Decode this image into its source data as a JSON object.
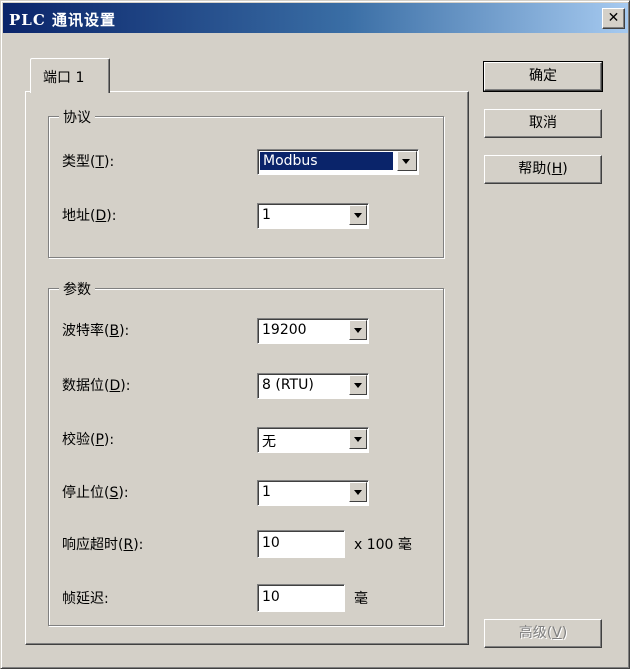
{
  "window": {
    "title": "PLC 通讯设置",
    "close_label": "✕"
  },
  "tabs": [
    {
      "label": "端口 1"
    }
  ],
  "protocol_group": {
    "title": "协议",
    "type": {
      "label_pre": "类型(",
      "hotkey": "T",
      "label_post": "):",
      "value": "Modbus"
    },
    "address": {
      "label_pre": "地址(",
      "hotkey": "D",
      "label_post": "):",
      "value": "1"
    }
  },
  "params_group": {
    "title": "参数",
    "baud": {
      "label_pre": "波特率(",
      "hotkey": "B",
      "label_post": "):",
      "value": "19200"
    },
    "databits": {
      "label_pre": "数据位(",
      "hotkey": "D",
      "label_post": "):",
      "value": "8 (RTU)"
    },
    "parity": {
      "label_pre": "校验(",
      "hotkey": "P",
      "label_post": "):",
      "value": "无"
    },
    "stopbits": {
      "label_pre": "停止位(",
      "hotkey": "S",
      "label_post": "):",
      "value": "1"
    },
    "timeout": {
      "label_pre": "响应超时(",
      "hotkey": "R",
      "label_post": "):",
      "value": "10",
      "unit": "x 100 毫"
    },
    "frame_delay": {
      "label": "帧延迟:",
      "value": "10",
      "unit": "毫"
    }
  },
  "buttons": {
    "ok": {
      "label": "确定"
    },
    "cancel": {
      "label": "取消"
    },
    "help": {
      "label_pre": "帮助(",
      "hotkey": "H",
      "label_post": ")"
    },
    "advanced": {
      "label_pre": "高级(",
      "hotkey": "V",
      "label_post": ")"
    }
  }
}
